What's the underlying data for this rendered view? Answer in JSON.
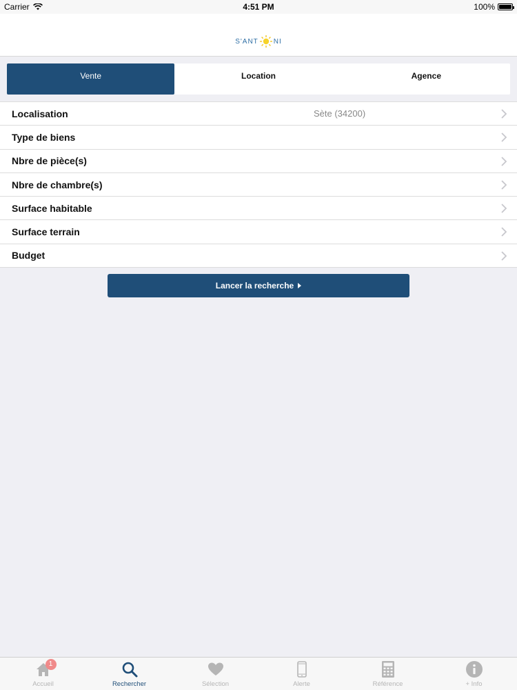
{
  "status_bar": {
    "carrier": "Carrier",
    "time": "4:51 PM",
    "battery": "100%"
  },
  "header": {
    "logo_left": "S'ANT",
    "logo_right": "NI"
  },
  "segments": [
    {
      "label": "Vente",
      "active": true
    },
    {
      "label": "Location",
      "active": false
    },
    {
      "label": "Agence",
      "active": false
    }
  ],
  "rows": [
    {
      "label": "Localisation",
      "value": "Sète (34200)"
    },
    {
      "label": "Type de biens",
      "value": ""
    },
    {
      "label": "Nbre de pièce(s)",
      "value": ""
    },
    {
      "label": "Nbre de chambre(s)",
      "value": ""
    },
    {
      "label": "Surface habitable",
      "value": ""
    },
    {
      "label": "Surface terrain",
      "value": ""
    },
    {
      "label": "Budget",
      "value": ""
    }
  ],
  "search_button": {
    "label": "Lancer la recherche"
  },
  "tabs": [
    {
      "label": "Accueil",
      "icon": "home-icon",
      "badge": "1"
    },
    {
      "label": "Rechercher",
      "icon": "search-icon",
      "active": true
    },
    {
      "label": "Sélection",
      "icon": "heart-icon"
    },
    {
      "label": "Alerte",
      "icon": "phone-icon"
    },
    {
      "label": "Référence",
      "icon": "calculator-icon"
    },
    {
      "label": "+ Info",
      "icon": "info-icon"
    }
  ],
  "colors": {
    "primary": "#1f4e78",
    "background": "#efeff4",
    "badge": "#f08a8a",
    "inactive_tab": "#b5b5b5"
  }
}
